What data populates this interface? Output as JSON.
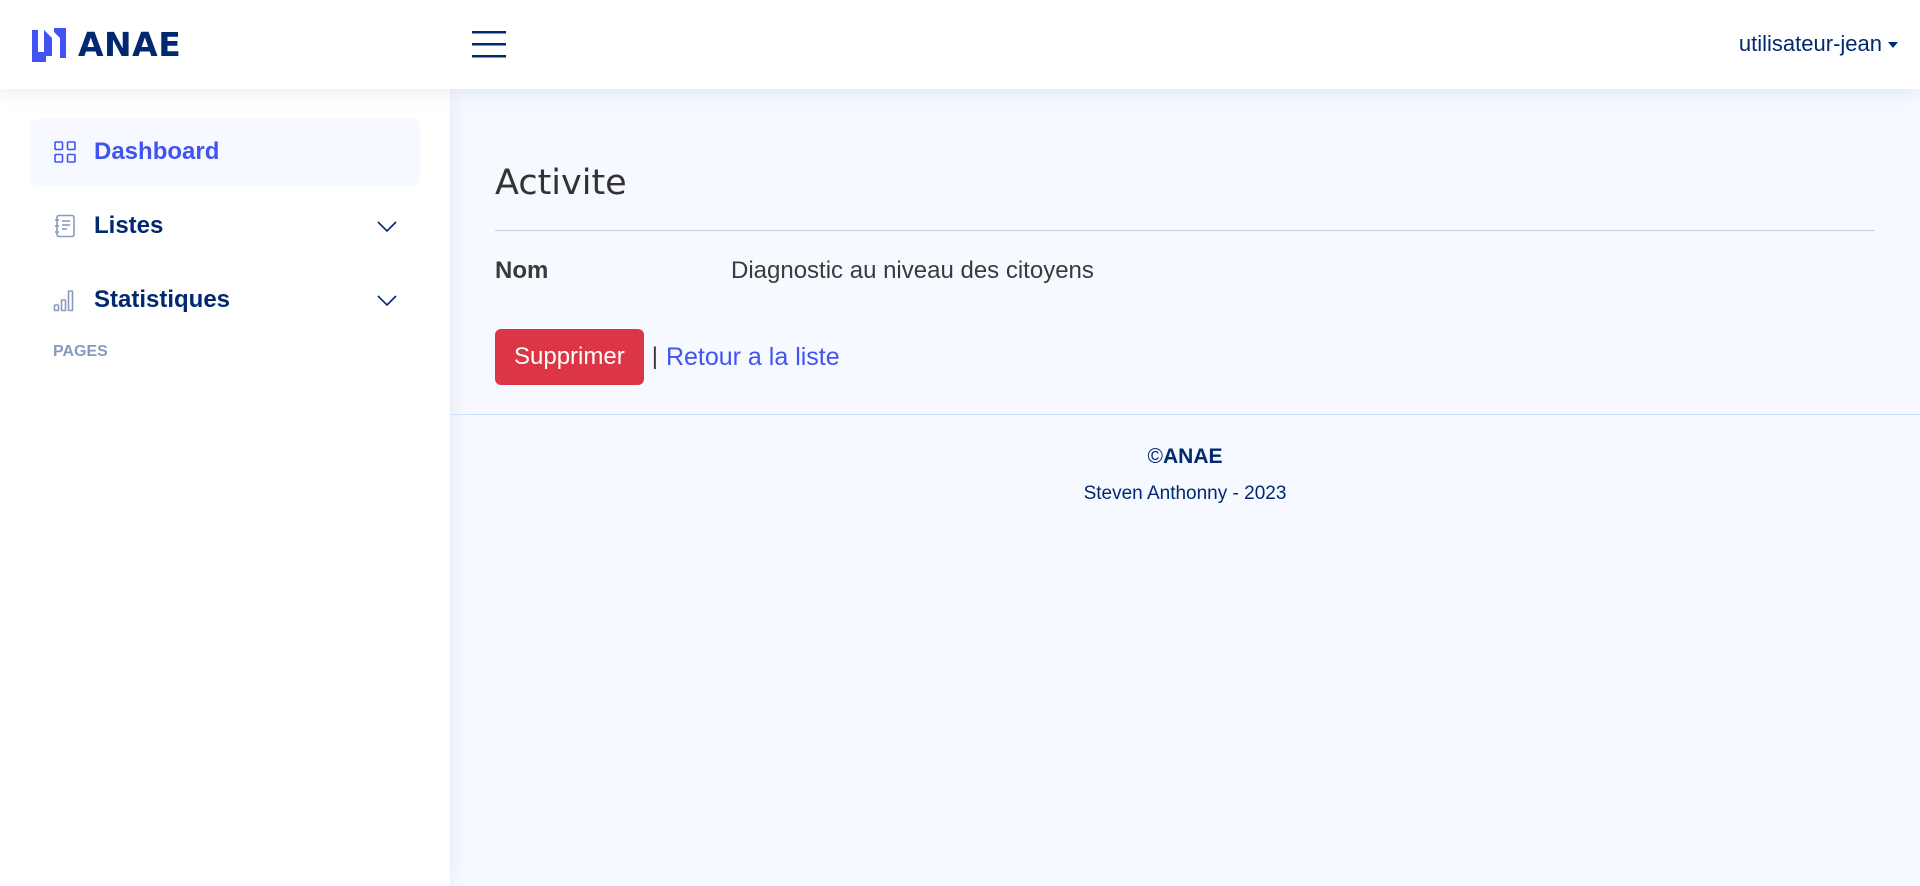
{
  "header": {
    "brand": "ANAE",
    "user": "utilisateur-jean",
    "icons": {
      "logo": "anae-logo",
      "toggle": "hamburger-icon",
      "caret": "caret-down-icon"
    }
  },
  "sidebar": {
    "items": [
      {
        "label": "Dashboard",
        "icon": "grid-icon",
        "active": true
      },
      {
        "label": "Listes",
        "icon": "journal-text-icon",
        "expandable": true
      },
      {
        "label": "Statistiques",
        "icon": "bar-chart-icon",
        "expandable": true
      }
    ],
    "heading": "PAGES"
  },
  "main": {
    "title": "Activite",
    "field_label": "Nom",
    "field_value": "Diagnostic au niveau des citoyens",
    "delete_label": "Supprimer",
    "separator": "|",
    "back_label": "Retour a la liste"
  },
  "footer": {
    "copyright": "©",
    "brand": "ANAE",
    "credit": "Steven Anthonny - 2023"
  },
  "colors": {
    "primary": "#4154f1",
    "navy": "#012970",
    "danger": "#dc3545",
    "background": "#f6f9ff"
  }
}
